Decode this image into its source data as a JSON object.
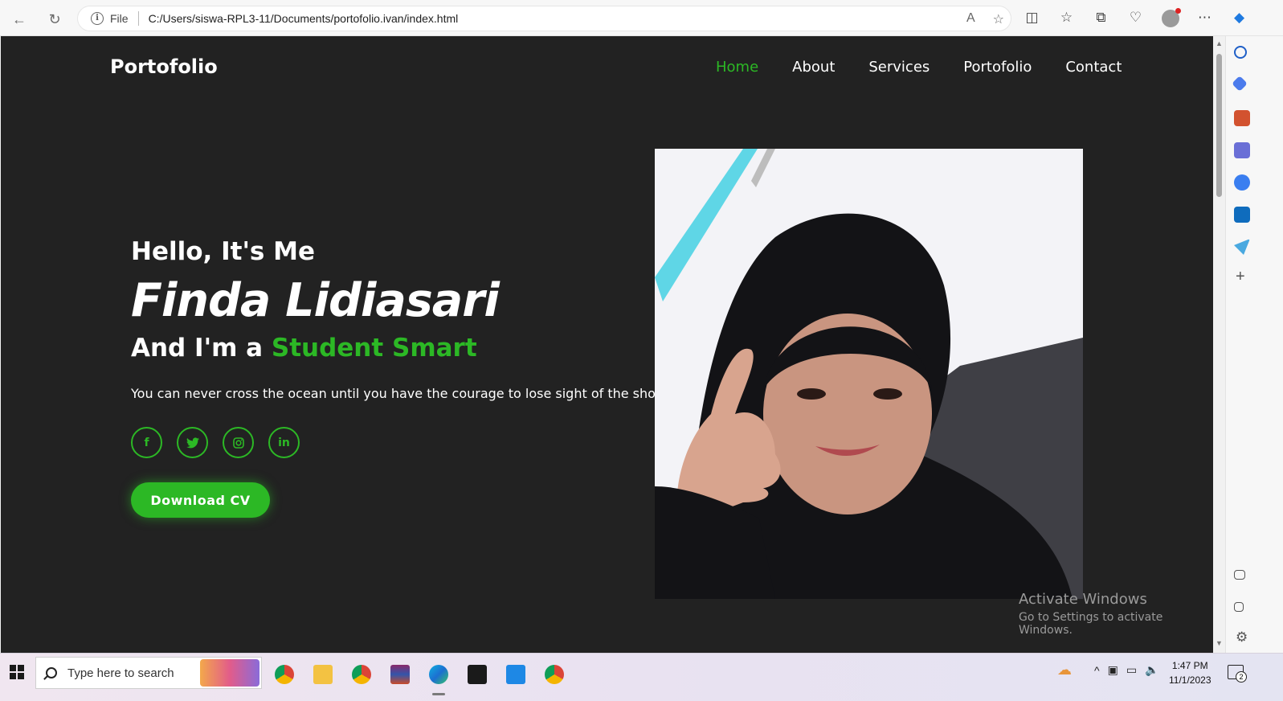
{
  "browser": {
    "address_prefix": "File",
    "url": "C:/Users/siswa-RPL3-11/Documents/portofolio.ivan/index.html"
  },
  "site": {
    "logo": "Portofolio",
    "nav": [
      "Home",
      "About",
      "Services",
      "Portofolio",
      "Contact"
    ],
    "active_nav": "Home",
    "accent_color": "#2cb825",
    "background_color": "#222222"
  },
  "hero": {
    "greeting": "Hello, It's Me",
    "name": "Finda Lidiasari",
    "role_prefix": "And I'm a ",
    "role_highlight": "Student Smart",
    "quote": "You can never cross the ocean until you have the courage to lose sight of the shore",
    "socials": [
      {
        "icon": "facebook-icon",
        "glyph": "f"
      },
      {
        "icon": "twitter-icon",
        "glyph": "🐦"
      },
      {
        "icon": "instagram-icon",
        "glyph": "◎"
      },
      {
        "icon": "linkedin-icon",
        "glyph": "in"
      }
    ],
    "cta": "Download CV"
  },
  "watermark": {
    "title": "Activate Windows",
    "subtitle": "Go to Settings to activate Windows."
  },
  "taskbar": {
    "search_placeholder": "Type here to search",
    "time": "1:47 PM",
    "date": "11/1/2023",
    "notification_count": "2"
  }
}
